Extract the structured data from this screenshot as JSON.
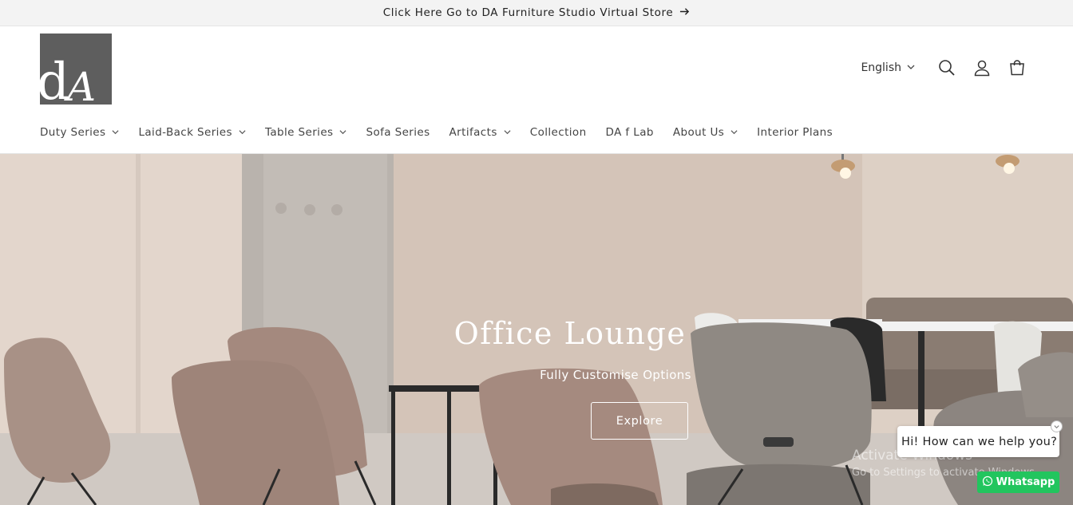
{
  "announcement": {
    "text": "Click Here Go to DA Furniture Studio Virtual Store",
    "icon": "arrow-right-icon"
  },
  "header": {
    "logo_text": "dA",
    "language": "English",
    "icons": [
      "search-icon",
      "account-icon",
      "cart-icon"
    ]
  },
  "nav": {
    "items": [
      {
        "label": "Duty Series",
        "dropdown": true
      },
      {
        "label": "Laid-Back Series",
        "dropdown": true
      },
      {
        "label": "Table Series",
        "dropdown": true
      },
      {
        "label": "Sofa Series",
        "dropdown": false
      },
      {
        "label": "Artifacts",
        "dropdown": true
      },
      {
        "label": "Collection",
        "dropdown": false
      },
      {
        "label": "DA f Lab",
        "dropdown": false
      },
      {
        "label": "About Us",
        "dropdown": true
      },
      {
        "label": "Interior Plans",
        "dropdown": false
      }
    ]
  },
  "hero": {
    "title": "Office Lounge",
    "subtitle": "Fully Customise Options",
    "button_label": "Explore"
  },
  "watermark": {
    "line1": "Activate Windows",
    "line2": "Go to Settings to activate Windows."
  },
  "chat": {
    "greeting": "Hi! How can we help you?",
    "whatsapp_label": "Whatsapp",
    "whatsapp_color": "#22c55e"
  }
}
